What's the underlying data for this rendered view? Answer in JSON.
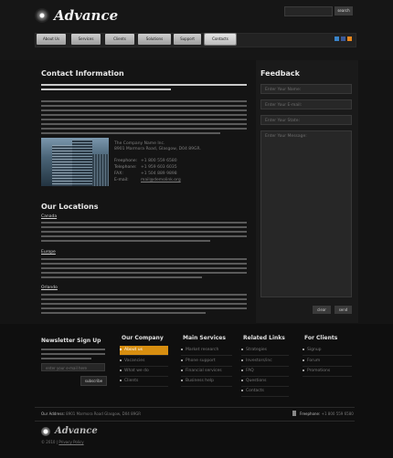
{
  "brand": {
    "name": "Advance"
  },
  "search": {
    "button": "search"
  },
  "nav": [
    {
      "label": "About Us",
      "active": false
    },
    {
      "label": "Services",
      "active": false
    },
    {
      "label": "Clients",
      "active": false
    },
    {
      "label": "Solutions",
      "active": false
    },
    {
      "label": "Support",
      "active": false
    },
    {
      "label": "Contacts",
      "active": true
    }
  ],
  "social_icons": [
    "twitter-icon",
    "facebook-icon",
    "rss-icon"
  ],
  "contact": {
    "title": "Contact Information",
    "company": "The Company Name Inc.",
    "street": "8901 Marmora Road, Glasgow, D04 89GR.",
    "freephone_label": "Freephone:",
    "freephone": "+1 800 559 6580",
    "telephone_label": "Telephone:",
    "telephone": "+1 959 603 6035",
    "fax_label": "FAX:",
    "fax": "+1 504 889 9898",
    "email_label": "E-mail:",
    "email": "mail@demolink.org"
  },
  "locations": {
    "title": "Our Locations",
    "items": [
      "Canada",
      "Europe",
      "Orlando"
    ]
  },
  "feedback": {
    "title": "Feedback",
    "name_placeholder": "Enter Your Name:",
    "email_placeholder": "Enter Your E-mail:",
    "state_placeholder": "Enter Your State:",
    "message_placeholder": "Enter Your Message:",
    "clear": "clear",
    "send": "send"
  },
  "footer": {
    "newsletter": {
      "title": "Newsletter Sign Up",
      "placeholder": "enter your e-mail here",
      "button": "subscribe"
    },
    "columns": [
      {
        "title": "Our Company",
        "items": [
          "About us",
          "Vacancies",
          "What we do",
          "Clients"
        ],
        "active_index": 0
      },
      {
        "title": "Main Services",
        "items": [
          "Market research",
          "Phone support",
          "Financial services",
          "Business help"
        ],
        "active_index": -1
      },
      {
        "title": "Related Links",
        "items": [
          "Strategies",
          "Investors/inc",
          "FAQ",
          "Questions",
          "Contacts"
        ],
        "active_index": -1
      },
      {
        "title": "For Clients",
        "items": [
          "Signup",
          "Forum",
          "Promotions"
        ],
        "active_index": -1
      }
    ],
    "address_label": "Our Address:",
    "address": "8901 Marmora Road Glasgow, D04 89GR",
    "phone_label": "Freephone:",
    "phone": "+1 800 559 6580",
    "copyright": "© 2010",
    "privacy": "Privacy Policy"
  },
  "colors": {
    "accent": "#d78e10",
    "background": "#141414"
  }
}
